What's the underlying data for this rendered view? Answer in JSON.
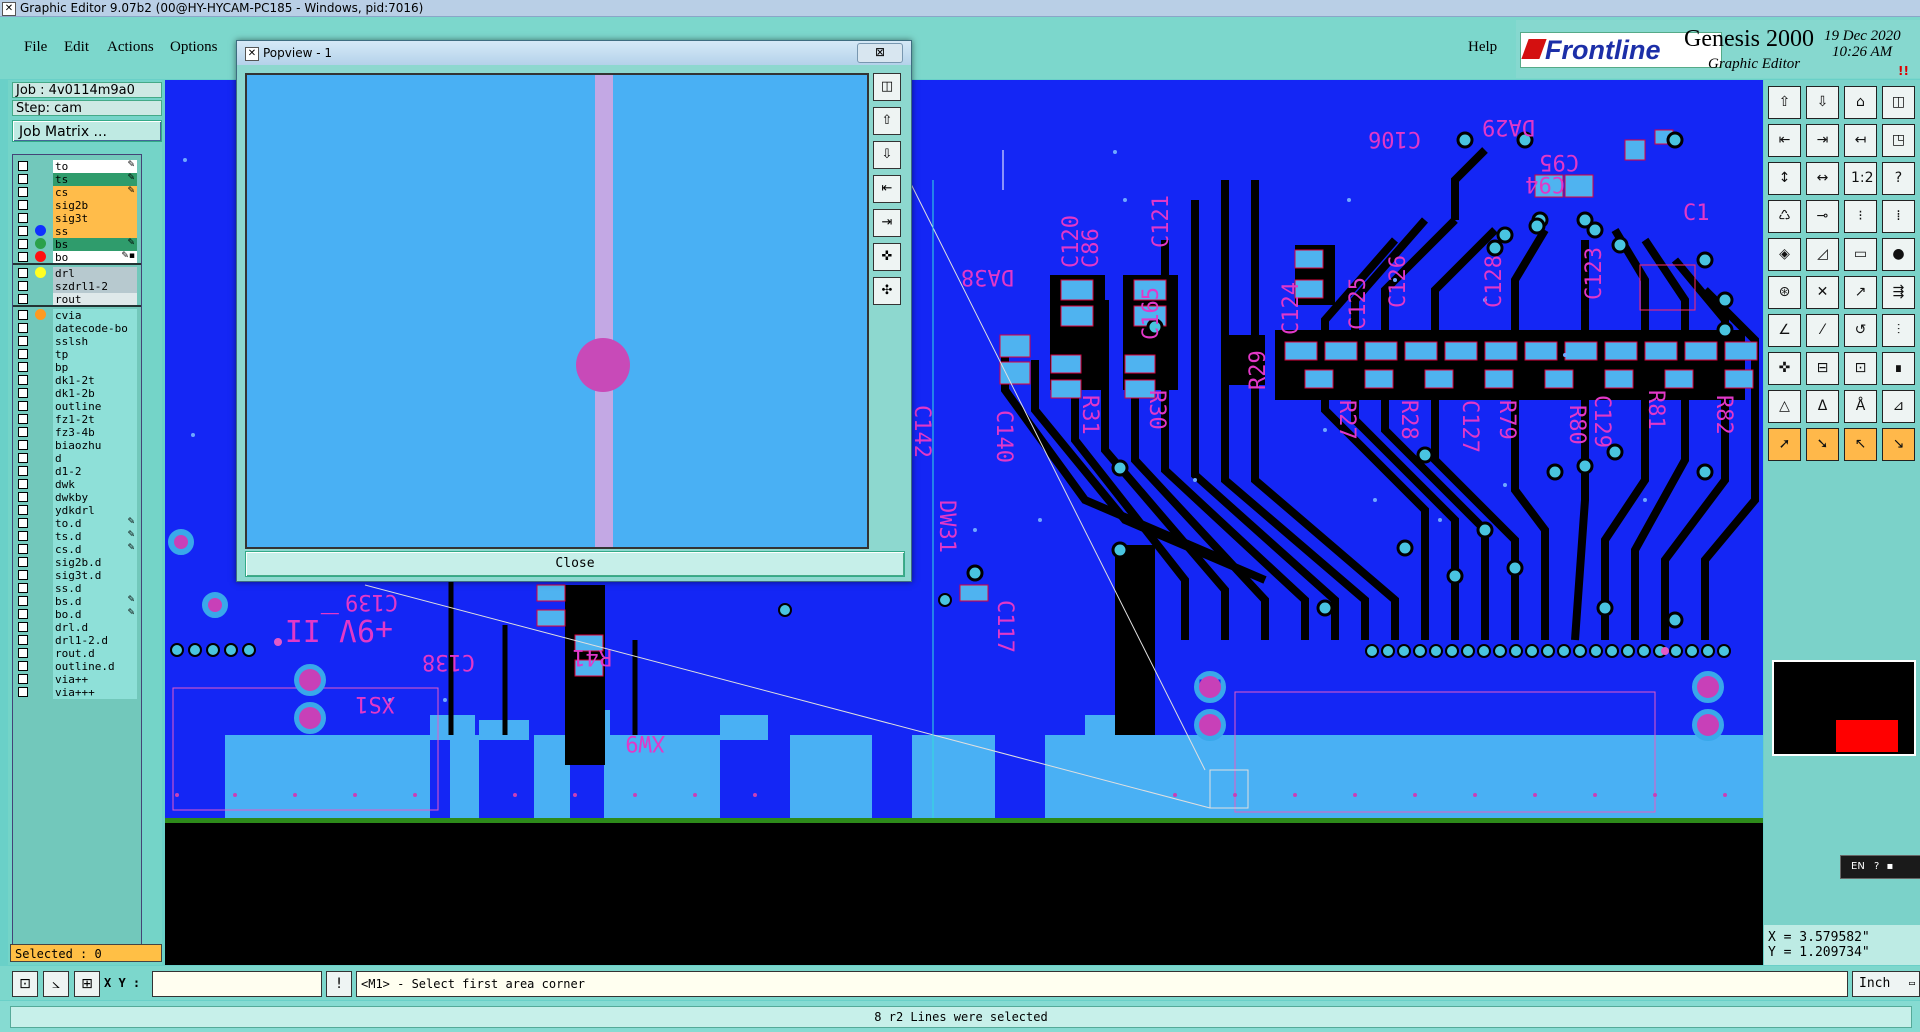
{
  "window": {
    "title": "Graphic Editor 9.07b2 (00@HY-HYCAM-PC185 - Windows, pid:7016)"
  },
  "menu": {
    "items": [
      "File",
      "Edit",
      "Actions",
      "Options"
    ],
    "help": "Help"
  },
  "brand": {
    "logo": "Frontline",
    "product": "Genesis 2000",
    "subtitle": "Graphic Editor",
    "date": "19 Dec 2020",
    "time": "10:26 AM",
    "alert": "!!"
  },
  "job": {
    "job_line": "Job : 4v0114m9a0",
    "step_line": "Step: cam",
    "matrix_button": "Job Matrix ..."
  },
  "layers": [
    {
      "name": "to",
      "color": "#ffffff",
      "dot": "",
      "flag": "✎"
    },
    {
      "name": "ts",
      "color": "#2f9c6c",
      "dot": "",
      "flag": "✎"
    },
    {
      "name": "cs",
      "color": "#ffbc4a",
      "dot": "",
      "flag": "✎"
    },
    {
      "name": "sig2b",
      "color": "#ffbc4a",
      "dot": "",
      "flag": ""
    },
    {
      "name": "sig3t",
      "color": "#ffbc4a",
      "dot": "",
      "flag": ""
    },
    {
      "name": "ss",
      "color": "#ffbc4a",
      "dot": "#1030ff",
      "flag": ""
    },
    {
      "name": "bs",
      "color": "#2f9c6c",
      "dot": "#2aa14a",
      "flag": "✎"
    },
    {
      "name": "bo",
      "color": "#ffffff",
      "dot": "#ff1010",
      "flag": "✎▪"
    },
    {
      "name": "drl",
      "color": "#b7c9cf",
      "dot": "#ffff20",
      "flag": ""
    },
    {
      "name": "szdrl1-2",
      "color": "#b7c9cf",
      "dot": "",
      "flag": ""
    },
    {
      "name": "rout",
      "color": "#dfe9ea",
      "dot": "",
      "flag": ""
    },
    {
      "name": "cvia",
      "color": "#8ee0d8",
      "dot": "#ff9a20",
      "flag": ""
    },
    {
      "name": "datecode-bo",
      "color": "#8ee0d8",
      "dot": "",
      "flag": ""
    },
    {
      "name": "sslsh",
      "color": "#8ee0d8",
      "dot": "",
      "flag": ""
    },
    {
      "name": "tp",
      "color": "#8ee0d8",
      "dot": "",
      "flag": ""
    },
    {
      "name": "bp",
      "color": "#8ee0d8",
      "dot": "",
      "flag": ""
    },
    {
      "name": "dk1-2t",
      "color": "#8ee0d8",
      "dot": "",
      "flag": ""
    },
    {
      "name": "dk1-2b",
      "color": "#8ee0d8",
      "dot": "",
      "flag": ""
    },
    {
      "name": "outline",
      "color": "#8ee0d8",
      "dot": "",
      "flag": ""
    },
    {
      "name": "fz1-2t",
      "color": "#8ee0d8",
      "dot": "",
      "flag": ""
    },
    {
      "name": "fz3-4b",
      "color": "#8ee0d8",
      "dot": "",
      "flag": ""
    },
    {
      "name": "biaozhu",
      "color": "#8ee0d8",
      "dot": "",
      "flag": ""
    },
    {
      "name": "d",
      "color": "#8ee0d8",
      "dot": "",
      "flag": ""
    },
    {
      "name": "d1-2",
      "color": "#8ee0d8",
      "dot": "",
      "flag": ""
    },
    {
      "name": "dwk",
      "color": "#8ee0d8",
      "dot": "",
      "flag": ""
    },
    {
      "name": "dwkby",
      "color": "#8ee0d8",
      "dot": "",
      "flag": ""
    },
    {
      "name": "ydkdrl",
      "color": "#8ee0d8",
      "dot": "",
      "flag": ""
    },
    {
      "name": "to.d",
      "color": "#8ee0d8",
      "dot": "",
      "flag": "✎"
    },
    {
      "name": "ts.d",
      "color": "#8ee0d8",
      "dot": "",
      "flag": "✎"
    },
    {
      "name": "cs.d",
      "color": "#8ee0d8",
      "dot": "",
      "flag": "✎"
    },
    {
      "name": "sig2b.d",
      "color": "#8ee0d8",
      "dot": "",
      "flag": ""
    },
    {
      "name": "sig3t.d",
      "color": "#8ee0d8",
      "dot": "",
      "flag": ""
    },
    {
      "name": "ss.d",
      "color": "#8ee0d8",
      "dot": "",
      "flag": ""
    },
    {
      "name": "bs.d",
      "color": "#8ee0d8",
      "dot": "",
      "flag": "✎"
    },
    {
      "name": "bo.d",
      "color": "#8ee0d8",
      "dot": "",
      "flag": "✎"
    },
    {
      "name": "drl.d",
      "color": "#8ee0d8",
      "dot": "",
      "flag": ""
    },
    {
      "name": "drl1-2.d",
      "color": "#8ee0d8",
      "dot": "",
      "flag": ""
    },
    {
      "name": "rout.d",
      "color": "#8ee0d8",
      "dot": "",
      "flag": ""
    },
    {
      "name": "outline.d",
      "color": "#8ee0d8",
      "dot": "",
      "flag": ""
    },
    {
      "name": "via++",
      "color": "#8ee0d8",
      "dot": "",
      "flag": ""
    },
    {
      "name": "via+++",
      "color": "#8ee0d8",
      "dot": "",
      "flag": ""
    }
  ],
  "selected": "Selected : 0",
  "pcb_labels": {
    "c106": "C106",
    "da29": "DA29",
    "c95": "C95",
    "c94": "C94",
    "da38": "DA38",
    "c120": "C120",
    "c86": "C86",
    "c121": "C121",
    "c165": "C165",
    "c124": "C124",
    "c125": "C125",
    "c126": "C126",
    "c128": "C128",
    "c123": "C123",
    "c1": "C1",
    "r29": "R29",
    "r31": "R31",
    "r30": "R30",
    "c142": "C142",
    "c140": "C140",
    "r27": "R27",
    "r28": "R28",
    "c127": "C127",
    "r79": "R79",
    "r80": "R80",
    "c129": "C129",
    "r81": "R81",
    "r82": "R82",
    "dw31": "DW31",
    "c117": "C117",
    "c139": "C139",
    "vpp": "+9V_II",
    "c138": "C138",
    "r41": "R41",
    "xs1": "XS1",
    "xw9": "XW9"
  },
  "popview": {
    "title": "Popview - 1",
    "close_x": "⊠",
    "close_button": "Close"
  },
  "toolbar_glyphs": [
    "⇧",
    "⇩",
    "⌂",
    "◫",
    "⇤",
    "⇥",
    "↤",
    "◳",
    "↕",
    "↔",
    "1:2",
    "?",
    "♺",
    "⊸",
    "⁝",
    "⁞",
    "◈",
    "◿",
    "▭",
    "●",
    "⊛",
    "✕",
    "↗",
    "⇶",
    "∠",
    "⁄",
    "↺",
    "⫶",
    "✜",
    "⊟",
    "⊡",
    "∎",
    "△",
    "Δ",
    "Å",
    "⊿",
    "➚",
    "➘",
    "↖",
    "↘"
  ],
  "coords": {
    "x": "X = 3.579582\"",
    "y": "Y = 1.209734\""
  },
  "lang_indicator": "EN",
  "command": {
    "xy_label": "X Y :",
    "xy_value": "",
    "prompt": "<M1> - Select first area corner",
    "units": "Inch"
  },
  "status": "8 r2 Lines were selected"
}
